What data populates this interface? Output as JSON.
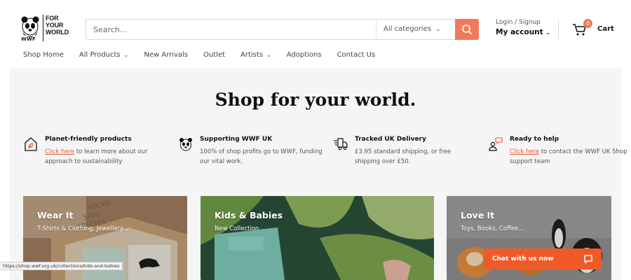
{
  "header": {
    "logo": {
      "brand": "WWF",
      "lines": [
        "FOR",
        "YOUR",
        "WORLD"
      ]
    },
    "search": {
      "placeholder": "Search...",
      "category": "All categories"
    },
    "account": {
      "login_label": "Login / Signup",
      "account_label": "My account"
    },
    "cart": {
      "count": "0",
      "label": "Cart"
    },
    "accent_color": "#f27a5a"
  },
  "nav": {
    "items": [
      {
        "label": "Shop Home",
        "has_dropdown": false
      },
      {
        "label": "All Products",
        "has_dropdown": true
      },
      {
        "label": "New Arrivals",
        "has_dropdown": false
      },
      {
        "label": "Outlet",
        "has_dropdown": false
      },
      {
        "label": "Artists",
        "has_dropdown": true
      },
      {
        "label": "Adoptions",
        "has_dropdown": false
      },
      {
        "label": "Contact Us",
        "has_dropdown": false
      }
    ]
  },
  "hero": {
    "title": "Shop for your world."
  },
  "features": [
    {
      "icon": "leaf-house-icon",
      "title": "Planet-friendly products",
      "link": "Click here",
      "desc_after_link": " to learn more about our approach to sustainability",
      "desc": ""
    },
    {
      "icon": "panda-icon",
      "title": "Supporting WWF UK",
      "link": "",
      "desc_after_link": "",
      "desc": "100% of shop profits go to WWF, funding our vital work."
    },
    {
      "icon": "delivery-truck-icon",
      "title": "Tracked UK Delivery",
      "link": "",
      "desc_after_link": "",
      "desc": "£3.95 standard shipping, or free shipping over £50."
    },
    {
      "icon": "support-chat-icon",
      "title": "Ready to help",
      "link": "Click here",
      "desc_after_link": " to contact the WWF UK Shop support team",
      "desc": ""
    }
  ],
  "cards": [
    {
      "title": "Wear It",
      "subtitle": "T-Shirts & Clothing, Jewellery..."
    },
    {
      "title": "Kids & Babies",
      "subtitle": "New Collection"
    },
    {
      "title": "Love It",
      "subtitle": "Toys, Books, Coffee..."
    }
  ],
  "chat": {
    "label": "Chat with us now",
    "color": "#f05a28"
  },
  "status_url": "https://shop.wwf.org.uk/collections/kids-and-babies"
}
